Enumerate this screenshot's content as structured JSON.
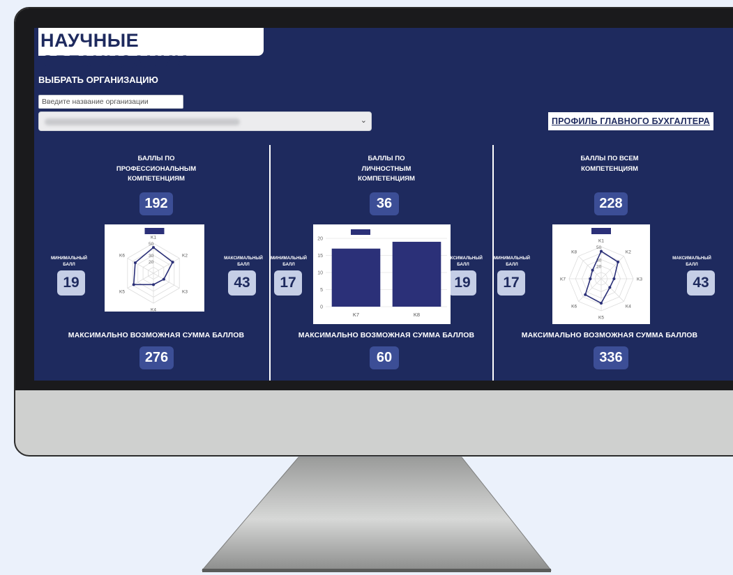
{
  "page": {
    "title": "НАУЧНЫЕ ОРГАНИЗАЦИИ",
    "select_label": "ВЫБРАТЬ ОРГАНИЗАЦИЮ",
    "search_placeholder": "Введите название организации",
    "profile_link": "ПРОФИЛЬ ГЛАВНОГО БУХГАЛТЕРА"
  },
  "panels": [
    {
      "heading_lines": [
        "БАЛЛЫ ПО",
        "ПРОФЕССИОНАЛЬНЫМ",
        "КОМПЕТЕНЦИЯМ"
      ],
      "total": "192",
      "min_label_lines": [
        "МИНИМАЛЬНЫЙ",
        "БАЛЛ"
      ],
      "min_value": "19",
      "max_label_lines": [
        "МАКСИМАЛЬНЫЙ",
        "БАЛЛ"
      ],
      "max_value": "43",
      "footer_label": "МАКСИМАЛЬНО ВОЗМОЖНАЯ СУММА БАЛЛОВ",
      "footer_value": "276"
    },
    {
      "heading_lines": [
        "БАЛЛЫ ПО",
        "ЛИЧНОСТНЫМ",
        "КОМПЕТЕНЦИЯМ"
      ],
      "total": "36",
      "min_label_lines": [
        "МИНИМАЛЬНЫЙ",
        "БАЛЛ"
      ],
      "min_value": "17",
      "max_label_lines": [
        "МАКСИМАЛЬНЫЙ",
        "БАЛЛ"
      ],
      "max_value": "19",
      "footer_label": "МАКСИМАЛЬНО ВОЗМОЖНАЯ СУММА БАЛЛОВ",
      "footer_value": "60"
    },
    {
      "heading_lines": [
        "БАЛЛЫ ПО ВСЕМ",
        "КОМПЕТЕНЦИЯМ"
      ],
      "total": "228",
      "min_label_lines": [
        "МИНИМАЛЬНЫЙ",
        "БАЛЛ"
      ],
      "min_value": "17",
      "max_label_lines": [
        "МАКСИМАЛЬНЫЙ",
        "БАЛЛ"
      ],
      "max_value": "43",
      "footer_label": "МАКСИМАЛЬНО ВОЗМОЖНАЯ СУММА БАЛЛОВ",
      "footer_value": "336"
    }
  ],
  "colors": {
    "screen_bg": "#1e2a5e",
    "accent": "#2b3078",
    "value_box": "#3c4e96",
    "value_box_light": "#c5cee6"
  },
  "chart_data": [
    {
      "type": "radar",
      "categories": [
        "K1",
        "K2",
        "K3",
        "K4",
        "K5",
        "K6"
      ],
      "values": [
        43,
        37,
        20,
        19,
        38,
        35
      ],
      "ticks": [
        "20",
        "30",
        "50"
      ],
      "rlim": [
        0,
        50
      ],
      "legend": "top"
    },
    {
      "type": "bar",
      "categories": [
        "K7",
        "K8"
      ],
      "values": [
        17,
        19
      ],
      "yticks": [
        "0",
        "5",
        "10",
        "15",
        "20"
      ],
      "ylim": [
        0,
        20
      ],
      "legend": "top"
    },
    {
      "type": "radar",
      "categories": [
        "K1",
        "K2",
        "K3",
        "K4",
        "K5",
        "K6",
        "K7",
        "K8"
      ],
      "values": [
        43,
        37,
        20,
        19,
        38,
        35,
        17,
        19
      ],
      "ticks": [
        "20",
        "30",
        "50"
      ],
      "rlim": [
        0,
        50
      ],
      "legend": "top"
    }
  ]
}
